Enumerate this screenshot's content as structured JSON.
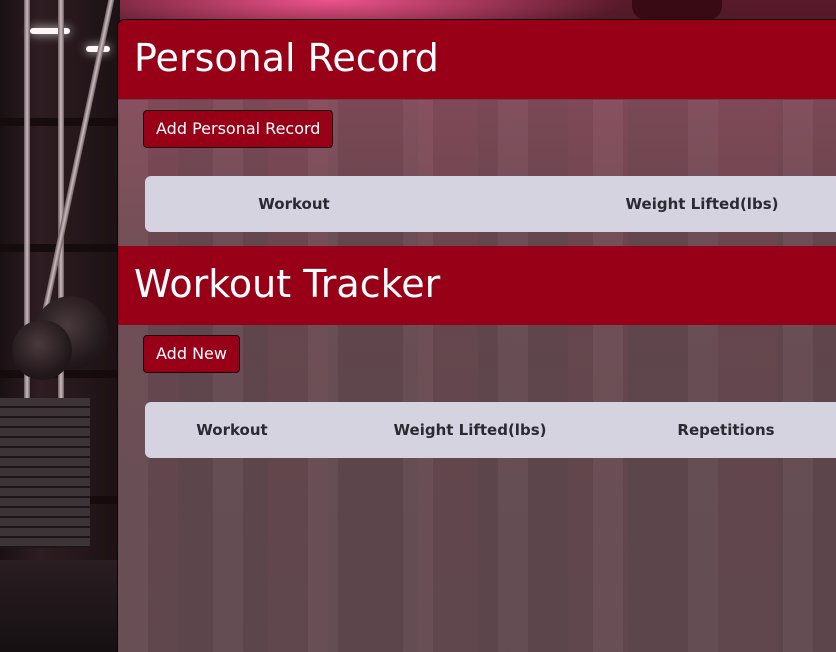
{
  "personal_record": {
    "title": "Personal Record",
    "add_button_label": "Add Personal Record",
    "columns": [
      "Workout",
      "Weight Lifted(lbs)"
    ]
  },
  "workout_tracker": {
    "title": "Workout Tracker",
    "add_button_label": "Add New",
    "columns": [
      "Workout",
      "Weight Lifted(lbs)",
      "Repetitions"
    ]
  },
  "colors": {
    "header_background": "#980018",
    "button_background": "#980018",
    "table_header_background": "#d6d3e0",
    "title_text": "#ffffff",
    "column_text": "#2a2a30"
  }
}
